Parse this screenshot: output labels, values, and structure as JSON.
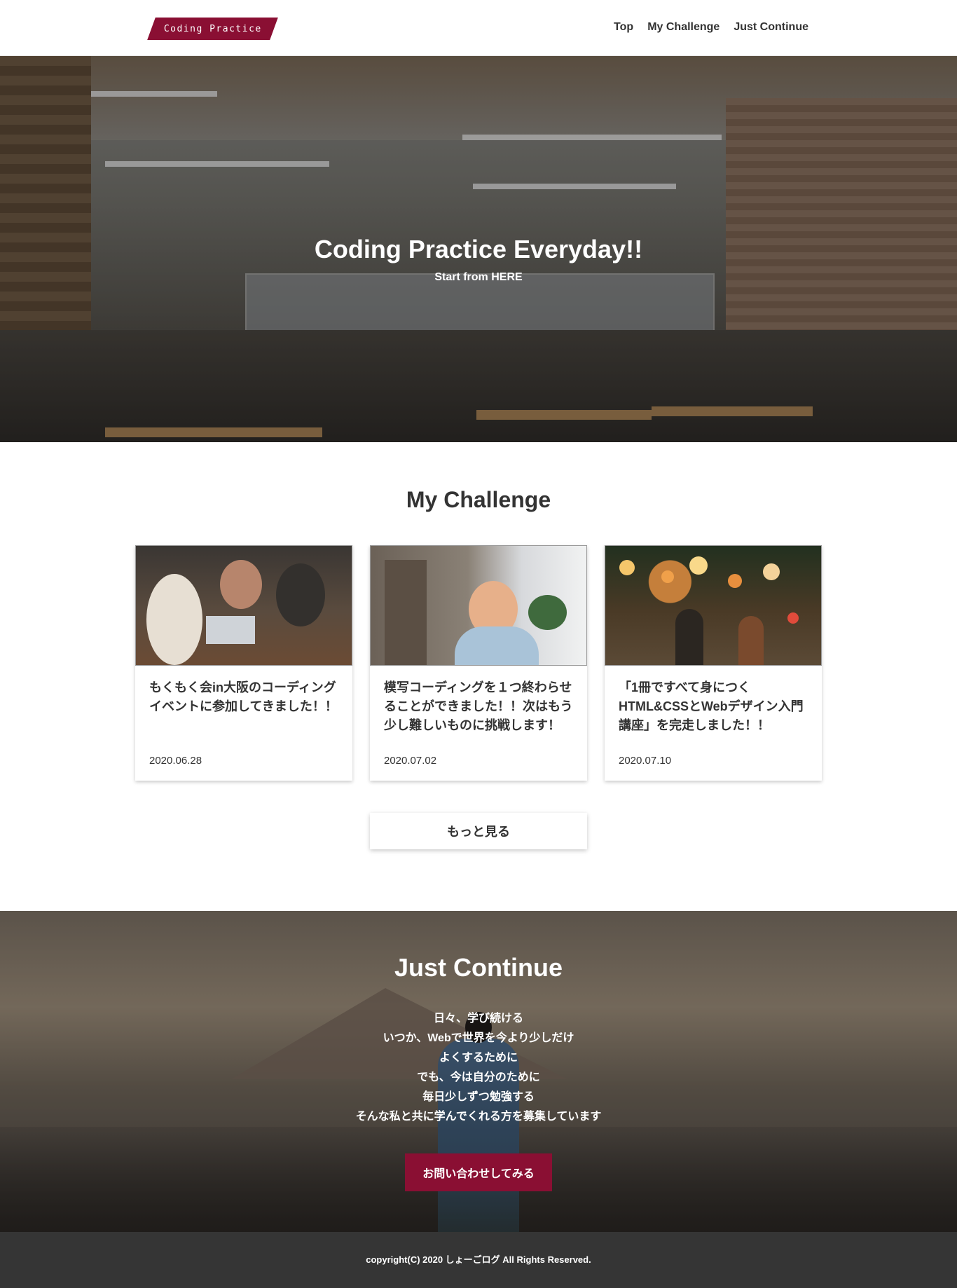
{
  "header": {
    "logo_text": "Coding Practice",
    "nav": [
      "Top",
      "My Challenge",
      "Just Continue"
    ]
  },
  "hero": {
    "title": "Coding Practice Everyday!!",
    "subtitle": "Start from HERE"
  },
  "challenge": {
    "title": "My Challenge",
    "cards": [
      {
        "title": "もくもく会in大阪のコーディングイベントに参加してきました！！",
        "date": "2020.06.28"
      },
      {
        "title": "模写コーディングを１つ終わらせることができました！！次はもう少し難しいものに挑戦します！",
        "date": "2020.07.02"
      },
      {
        "title": "「1冊ですべて身につくHTML&CSSとWebデザイン入門講座」を完走しました！！",
        "date": "2020.07.10"
      }
    ],
    "more_label": "もっと見る"
  },
  "continue": {
    "title": "Just Continue",
    "lines": [
      "日々、学び続ける",
      "いつか、Webで世界を今より少しだけ",
      "よくするために",
      "でも、今は自分のために",
      "毎日少しずつ勉強する",
      "そんな私と共に学んでくれる方を募集しています"
    ],
    "button_label": "お問い合わせしてみる"
  },
  "footer": {
    "copyright": "copyright(C) 2020 しょーごログ All Rights Reserved."
  },
  "colors": {
    "accent": "#8a0f33",
    "footer_bg": "#353535",
    "text": "#333333"
  }
}
